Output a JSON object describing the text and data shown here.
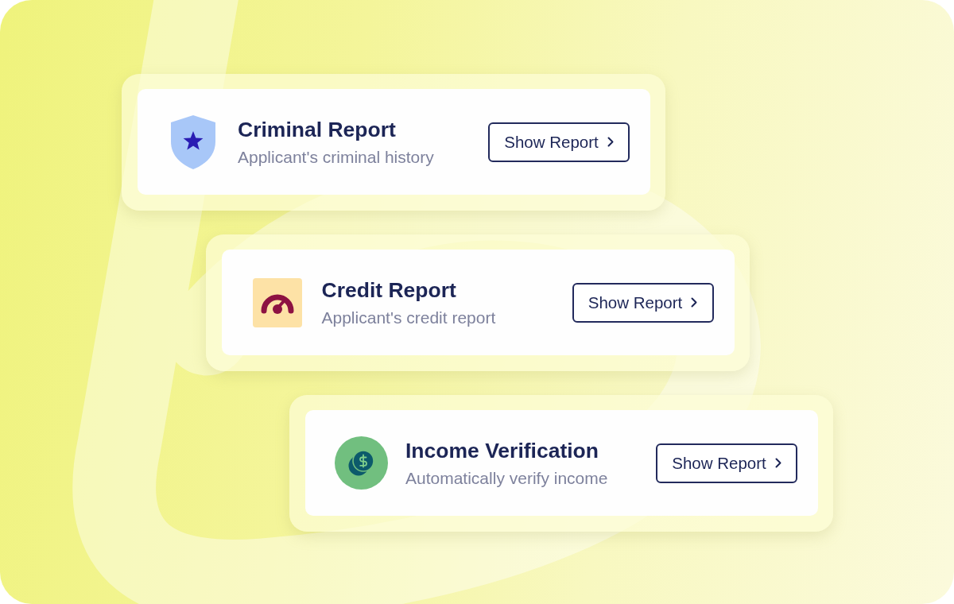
{
  "cards": [
    {
      "kind": "shield",
      "title": "Criminal Report",
      "subtitle": "Applicant's criminal history",
      "button": "Show Report"
    },
    {
      "kind": "gauge",
      "title": "Credit Report",
      "subtitle": "Applicant's credit report",
      "button": "Show Report"
    },
    {
      "kind": "coins",
      "title": "Income Verification",
      "subtitle": "Automatically verify income",
      "button": "Show Report"
    }
  ]
}
